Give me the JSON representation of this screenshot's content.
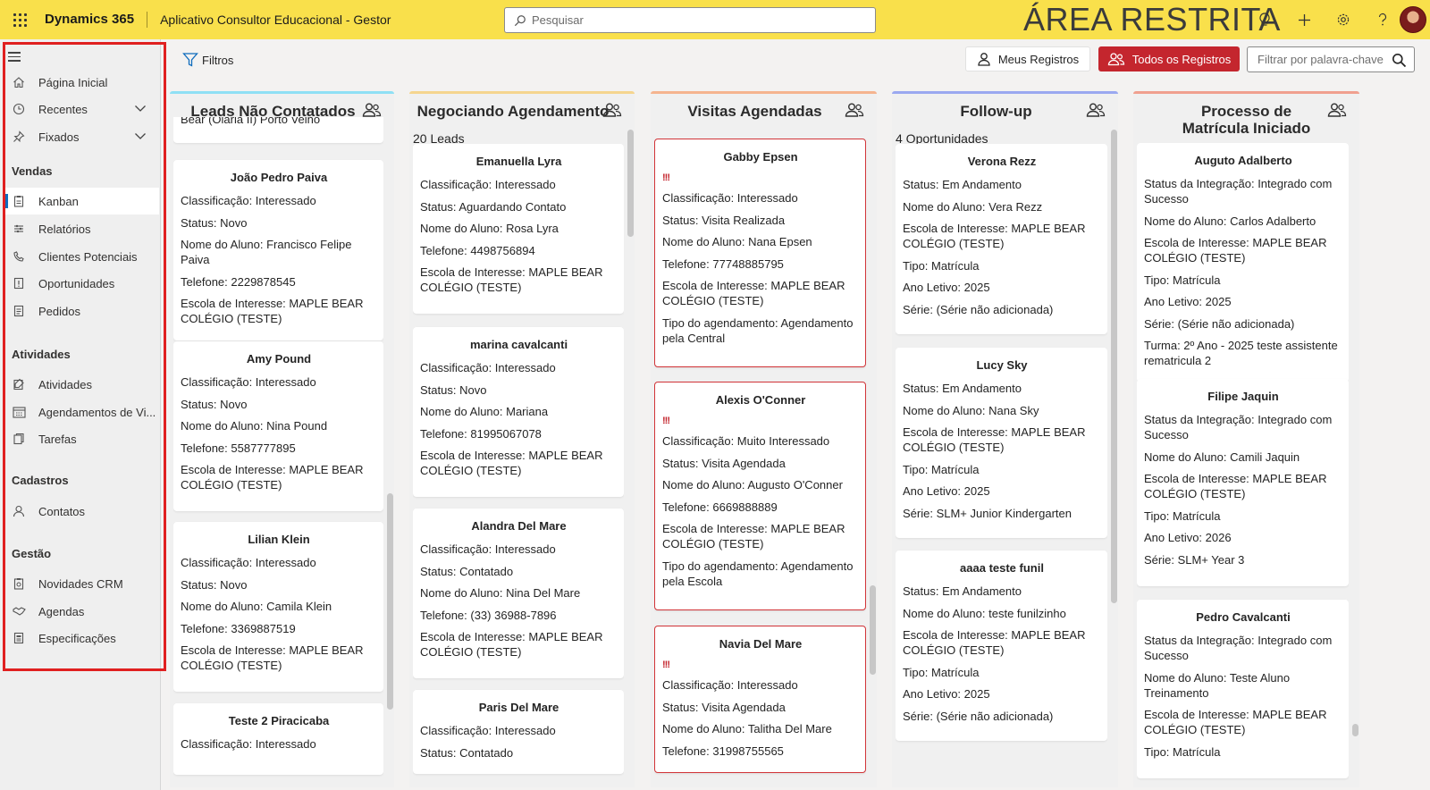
{
  "topbar": {
    "brand": "Dynamics 365",
    "app_name": "Aplicativo Consultor Educacional - Gestor",
    "search_placeholder": "Pesquisar",
    "restricted_label": "ÁREA RESTRITA"
  },
  "sidebar": {
    "home": "Página Inicial",
    "recent": "Recentes",
    "pinned": "Fixados",
    "sections": {
      "vendas": "Vendas",
      "atividades": "Atividades",
      "cadastros": "Cadastros",
      "gestao": "Gestão"
    },
    "items": {
      "kanban": "Kanban",
      "relatorios": "Relatórios",
      "clientes": "Clientes Potenciais",
      "oportunidades": "Oportunidades",
      "pedidos": "Pedidos",
      "atividades": "Atividades",
      "agendamentos": "Agendamentos de Vi...",
      "tarefas": "Tarefas",
      "contatos": "Contatos",
      "novidades": "Novidades CRM",
      "agendas": "Agendas",
      "especificacoes": "Especificações"
    }
  },
  "commandbar": {
    "filters": "Filtros",
    "my_records": "Meus Registros",
    "all_records": "Todos os Registros",
    "keyword_placeholder": "Filtrar por palavra-chave"
  },
  "columns": [
    {
      "title": "Leads Não Contatados",
      "color": "#8fe0f5",
      "count": "",
      "partial_top": "Bear (Olaria II) Porto Velho",
      "cards": [
        {
          "name": "João Pedro Paiva",
          "fields": [
            "Classificação: Interessado",
            "Status: Novo",
            "Nome do Aluno: Francisco Felipe Paiva",
            "Telefone: 2229878545",
            "Escola de Interesse: MAPLE BEAR COLÉGIO (TESTE)"
          ]
        },
        {
          "name": "Amy Pound",
          "fields": [
            "Classificação: Interessado",
            "Status: Novo",
            "Nome do Aluno: Nina Pound",
            "Telefone: 5587777895",
            "Escola de Interesse: MAPLE BEAR COLÉGIO (TESTE)"
          ]
        },
        {
          "name": "Lilian Klein",
          "fields": [
            "Classificação: Interessado",
            "Status: Novo",
            "Nome do Aluno: Camila Klein",
            "Telefone: 3369887519",
            "Escola de Interesse: MAPLE BEAR COLÉGIO (TESTE)"
          ]
        },
        {
          "name": "Teste 2 Piracicaba",
          "fields": [
            "Classificação: Interessado"
          ]
        }
      ]
    },
    {
      "title": "Negociando Agendamento",
      "color": "#f5d58f",
      "count": "20 Leads",
      "cards": [
        {
          "name": "Emanuella Lyra",
          "fields": [
            "Classificação: Interessado",
            "Status: Aguardando Contato",
            "Nome do Aluno: Rosa Lyra",
            "Telefone: 4498756894",
            "Escola de Interesse: MAPLE BEAR COLÉGIO (TESTE)"
          ]
        },
        {
          "name": "marina cavalcanti",
          "fields": [
            "Classificação: Interessado",
            "Status: Novo",
            "Nome do Aluno: Mariana",
            "Telefone: 81995067078",
            "Escola de Interesse: MAPLE BEAR COLÉGIO (TESTE)"
          ]
        },
        {
          "name": "Alandra Del Mare",
          "fields": [
            "Classificação: Interessado",
            "Status: Contatado",
            "Nome do Aluno: Nina Del Mare",
            "Telefone: (33) 36988-7896",
            "Escola de Interesse: MAPLE BEAR COLÉGIO (TESTE)"
          ]
        },
        {
          "name": "Paris Del Mare",
          "fields": [
            "Classificação: Interessado",
            "Status: Contatado"
          ]
        }
      ]
    },
    {
      "title": "Visitas Agendadas",
      "color": "#f5b48f",
      "count": "",
      "cards": [
        {
          "name": "Gabby Epsen",
          "prio": "!!!",
          "fields": [
            "Classificação: Interessado",
            "Status: Visita Realizada",
            "Nome do Aluno: Nana Epsen",
            "Telefone: 77748885795",
            "Escola de Interesse: MAPLE BEAR COLÉGIO (TESTE)",
            "Tipo do agendamento: Agendamento pela Central"
          ]
        },
        {
          "name": "Alexis O'Conner",
          "prio": "!!!",
          "fields": [
            "Classificação: Muito Interessado",
            "Status: Visita Agendada",
            "Nome do Aluno: Augusto O'Conner",
            "Telefone: 6669888889",
            "Escola de Interesse: MAPLE BEAR COLÉGIO (TESTE)",
            "Tipo do agendamento: Agendamento pela Escola"
          ]
        },
        {
          "name": "Navia Del Mare",
          "prio": "!!!",
          "fields": [
            "Classificação: Interessado",
            "Status: Visita Agendada",
            "Nome do Aluno: Talitha Del Mare",
            "Telefone: 31998755565"
          ]
        }
      ]
    },
    {
      "title": "Follow-up",
      "color": "#9aa8f0",
      "count": "4 Oportunidades",
      "cards": [
        {
          "name": "Verona Rezz",
          "fields": [
            "Status: Em Andamento",
            "Nome do Aluno: Vera Rezz",
            "Escola de Interesse: MAPLE BEAR COLÉGIO (TESTE)",
            "Tipo: Matrícula",
            "Ano Letivo: 2025",
            "Série: (Série não adicionada)"
          ]
        },
        {
          "name": "Lucy Sky",
          "fields": [
            "Status: Em Andamento",
            "Nome do Aluno: Nana Sky",
            "Escola de Interesse: MAPLE BEAR COLÉGIO (TESTE)",
            "Tipo: Matrícula",
            "Ano Letivo: 2025",
            "Série: SLM+ Junior Kindergarten"
          ]
        },
        {
          "name": "aaaa teste funil",
          "fields": [
            "Status: Em Andamento",
            "Nome do Aluno: teste funilzinho",
            "Escola de Interesse: MAPLE BEAR COLÉGIO (TESTE)",
            "Tipo: Matrícula",
            "Ano Letivo: 2025",
            "Série: (Série não adicionada)"
          ]
        }
      ]
    },
    {
      "title": "Processo de Matrícula Iniciado",
      "color": "#f0a08f",
      "count": "",
      "cards": [
        {
          "name": "Auguto Adalberto",
          "fields": [
            "Status da Integração: Integrado com Sucesso",
            "Nome do Aluno: Carlos Adalberto",
            "Escola de Interesse: MAPLE BEAR COLÉGIO (TESTE)",
            "Tipo: Matrícula",
            "Ano Letivo: 2025",
            "Série: (Série não adicionada)",
            "Turma: 2º Ano - 2025 teste assistente rematricula 2"
          ]
        },
        {
          "name": "Filipe Jaquin",
          "fields": [
            "Status da Integração: Integrado com Sucesso",
            "Nome do Aluno: Camili Jaquin",
            "Escola de Interesse: MAPLE BEAR COLÉGIO (TESTE)",
            "Tipo: Matrícula",
            "Ano Letivo: 2026",
            "Série: SLM+ Year 3"
          ]
        },
        {
          "name": "Pedro Cavalcanti",
          "fields": [
            "Status da Integração: Integrado com Sucesso",
            "Nome do Aluno: Teste Aluno Treinamento",
            "Escola de Interesse: MAPLE BEAR COLÉGIO (TESTE)",
            "Tipo: Matrícula"
          ]
        }
      ]
    }
  ]
}
